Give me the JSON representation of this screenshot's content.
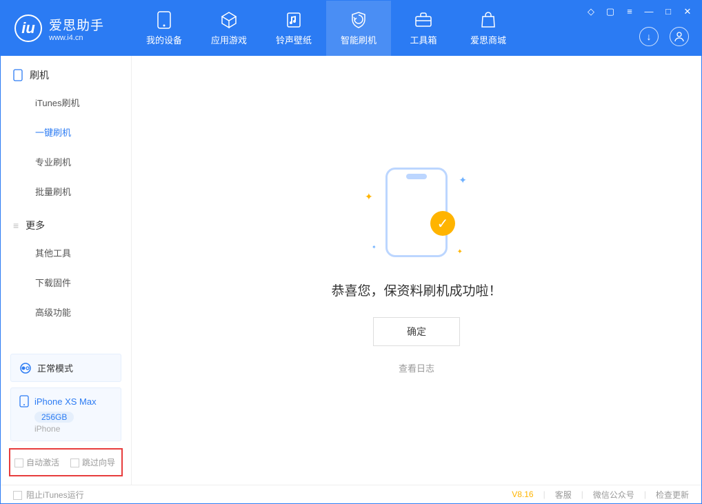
{
  "app": {
    "title": "爱思助手",
    "subtitle": "www.i4.cn"
  },
  "nav": {
    "items": [
      {
        "label": "我的设备"
      },
      {
        "label": "应用游戏"
      },
      {
        "label": "铃声壁纸"
      },
      {
        "label": "智能刷机"
      },
      {
        "label": "工具箱"
      },
      {
        "label": "爱思商城"
      }
    ]
  },
  "sidebar": {
    "group1": {
      "title": "刷机",
      "items": [
        "iTunes刷机",
        "一键刷机",
        "专业刷机",
        "批量刷机"
      ],
      "active_index": 1
    },
    "group2": {
      "title": "更多",
      "items": [
        "其他工具",
        "下载固件",
        "高级功能"
      ]
    },
    "mode": "正常模式",
    "device": {
      "name": "iPhone XS Max",
      "storage": "256GB",
      "type": "iPhone"
    },
    "checkboxes": {
      "auto_activate": "自动激活",
      "skip_guide": "跳过向导"
    }
  },
  "main": {
    "success_message": "恭喜您，保资料刷机成功啦！",
    "ok_button": "确定",
    "log_link": "查看日志"
  },
  "footer": {
    "block_itunes": "阻止iTunes运行",
    "version": "V8.16",
    "links": [
      "客服",
      "微信公众号",
      "检查更新"
    ]
  }
}
